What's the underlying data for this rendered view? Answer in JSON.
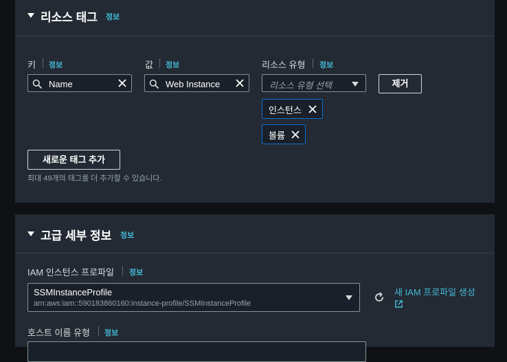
{
  "resource_tags": {
    "title": "리소스 태그",
    "info": "정보",
    "key": {
      "label": "키",
      "info": "정보",
      "value": "Name"
    },
    "value": {
      "label": "값",
      "info": "정보",
      "value": "Web Instance"
    },
    "resource_type": {
      "label": "리소스 유형",
      "info": "정보",
      "placeholder": "리소스 유형 선택",
      "tokens": [
        "인스턴스",
        "볼륨"
      ]
    },
    "remove_button": "제거",
    "add_tag_button": "새로운 태그 추가",
    "hint": "최대 49개의 태그를 더 추가할 수 있습니다."
  },
  "advanced": {
    "title": "고급 세부 정보",
    "info": "정보",
    "iam_profile": {
      "label": "IAM 인스턴스 프로파일",
      "info": "정보",
      "selected": "SSMInstanceProfile",
      "arn": "arn:aws:iam::590183860160:instance-profile/SSMInstanceProfile"
    },
    "new_iam_link": "새 IAM 프로파일 생성",
    "hostname_type": {
      "label": "호스트 이름 유형",
      "info": "정보"
    }
  },
  "colors": {
    "background": "#0f1114",
    "panel": "#232a33",
    "link": "#44b9d6",
    "token_border": "#0972d3"
  },
  "icons": [
    "caret-down-icon",
    "search-icon",
    "clear-icon",
    "dropdown-arrow-icon",
    "refresh-icon",
    "external-link-icon"
  ]
}
